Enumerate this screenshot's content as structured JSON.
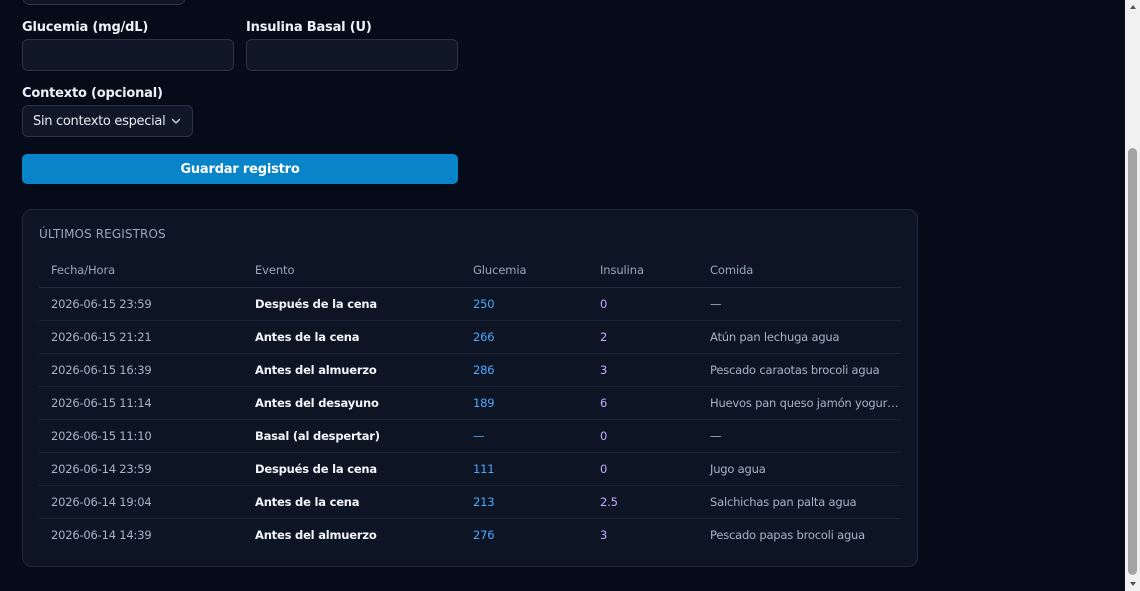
{
  "form": {
    "glucose_label": "Glucemia (mg/dL)",
    "glucose_value": "",
    "insulin_label": "Insulina Basal (U)",
    "insulin_value": "",
    "context_label": "Contexto (opcional)",
    "context_selected": "Sin contexto especial",
    "save_label": "Guardar registro"
  },
  "records": {
    "title": "ÚLTIMOS REGISTROS",
    "columns": [
      "Fecha/Hora",
      "Evento",
      "Glucemia",
      "Insulina",
      "Comida"
    ],
    "rows": [
      {
        "datetime": "2026-06-15 23:59",
        "event": "Después de la cena",
        "glucose": "250",
        "insulin": "0",
        "meal": "—"
      },
      {
        "datetime": "2026-06-15 21:21",
        "event": "Antes de la cena",
        "glucose": "266",
        "insulin": "2",
        "meal": "Atún pan lechuga agua"
      },
      {
        "datetime": "2026-06-15 16:39",
        "event": "Antes del almuerzo",
        "glucose": "286",
        "insulin": "3",
        "meal": "Pescado caraotas brocoli agua"
      },
      {
        "datetime": "2026-06-15 11:14",
        "event": "Antes del desayuno",
        "glucose": "189",
        "insulin": "6",
        "meal": "Huevos pan queso jamón yogurt..."
      },
      {
        "datetime": "2026-06-15 11:10",
        "event": "Basal (al despertar)",
        "glucose": "—",
        "insulin": "0",
        "meal": "—"
      },
      {
        "datetime": "2026-06-14 23:59",
        "event": "Después de la cena",
        "glucose": "111",
        "insulin": "0",
        "meal": "Jugo agua"
      },
      {
        "datetime": "2026-06-14 19:04",
        "event": "Antes de la cena",
        "glucose": "213",
        "insulin": "2.5",
        "meal": "Salchichas pan palta agua"
      },
      {
        "datetime": "2026-06-14 14:39",
        "event": "Antes del almuerzo",
        "glucose": "276",
        "insulin": "3",
        "meal": "Pescado papas brocoli agua"
      }
    ]
  },
  "icons": {
    "select": "chevron-down-icon",
    "scroll_up": "triangle-up-icon",
    "scroll_down": "triangle-down-icon"
  },
  "colors": {
    "background": "#050b18",
    "accent": "#0a84c8",
    "glucose_value": "#4da8ff",
    "insulin_value": "#c9a8ff"
  }
}
